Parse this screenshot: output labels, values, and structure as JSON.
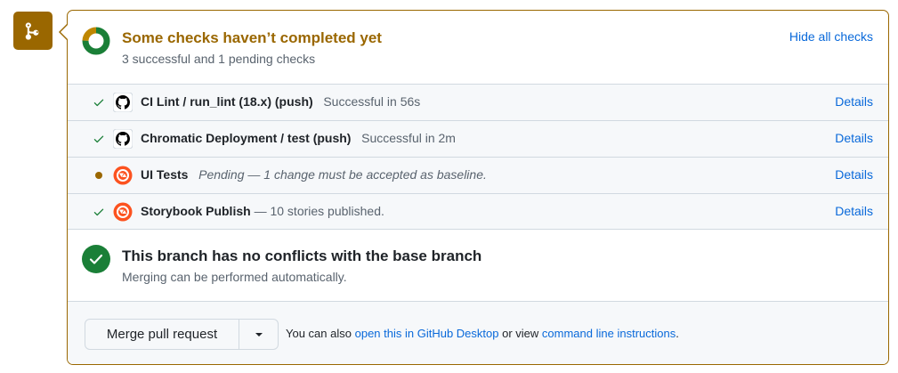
{
  "checks": {
    "title": "Some checks haven’t completed yet",
    "subtitle": "3 successful and 1 pending checks",
    "hide_link": "Hide all checks",
    "progress": {
      "successful": 3,
      "pending": 1
    },
    "items": [
      {
        "status": "success",
        "app": "github",
        "name": "CI Lint / run_lint (18.x) (push)",
        "desc": "Successful in 56s",
        "details": "Details"
      },
      {
        "status": "success",
        "app": "github",
        "name": "Chromatic Deployment / test (push)",
        "desc": "Successful in 2m",
        "details": "Details"
      },
      {
        "status": "pending",
        "app": "chromatic",
        "name": "UI Tests",
        "desc": "Pending — 1 change must be accepted as baseline.",
        "details": "Details"
      },
      {
        "status": "success",
        "app": "chromatic",
        "name": "Storybook Publish",
        "desc": "— 10 stories published.",
        "details": "Details"
      }
    ]
  },
  "conflicts": {
    "title": "This branch has no conflicts with the base branch",
    "subtitle": "Merging can be performed automatically."
  },
  "merge": {
    "button_label": "Merge pull request",
    "note_prefix": "You can also",
    "desktop_link": "open this in GitHub Desktop",
    "note_middle": "or view",
    "cli_link": "command line instructions",
    "note_suffix": "."
  },
  "colors": {
    "pending": "#9a6700",
    "success": "#1a7f37",
    "link": "#0969da",
    "chromatic": "#fc521f"
  }
}
